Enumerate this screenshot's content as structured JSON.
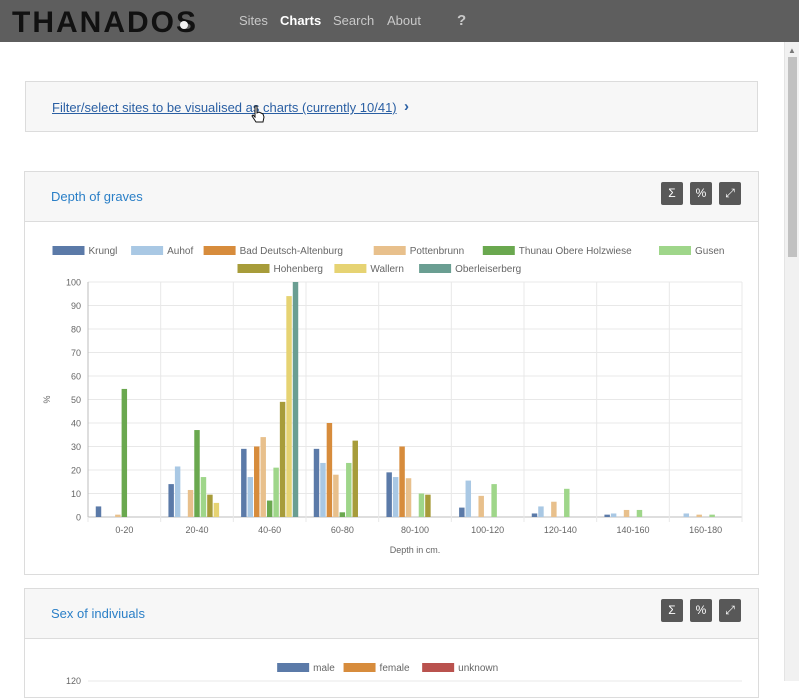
{
  "nav": {
    "logo_text": "THANADOS",
    "items": [
      "Sites",
      "Charts",
      "Search",
      "About"
    ],
    "active": "Charts",
    "help": "?"
  },
  "filter": {
    "link_text": "Filter/select sites to be visualised as charts (currently 10/41)",
    "chevron": "›"
  },
  "cards": [
    {
      "title": "Depth of graves",
      "buttons": [
        "Σ",
        "%",
        "⤢"
      ]
    },
    {
      "title": "Sex of indiviuals",
      "buttons": [
        "Σ",
        "%",
        "⤢"
      ]
    }
  ],
  "icons": [
    "logo-skull-icon",
    "help-icon",
    "chevron-right-icon",
    "sum-icon",
    "percent-icon",
    "expand-icon",
    "hand-cursor-icon"
  ],
  "chart_data": [
    {
      "type": "bar",
      "ylabel": "%",
      "xlabel": "Depth in cm.",
      "ylim": [
        0,
        100
      ],
      "yticks": [
        0,
        10,
        20,
        30,
        40,
        50,
        60,
        70,
        80,
        90,
        100
      ],
      "categories": [
        "0-20",
        "20-40",
        "40-60",
        "60-80",
        "80-100",
        "100-120",
        "120-140",
        "140-160",
        "160-180"
      ],
      "legend_position": "top",
      "grid": true,
      "series": [
        {
          "name": "Krungl",
          "color": "#5b7aa8",
          "values": [
            4.5,
            14,
            29,
            29,
            19,
            4,
            1.5,
            1,
            0
          ]
        },
        {
          "name": "Auhof",
          "color": "#a9c8e4",
          "values": [
            0,
            21.5,
            17,
            23,
            17,
            15.5,
            4.5,
            1.5,
            1.5
          ]
        },
        {
          "name": "Bad Deutsch-Altenburg",
          "color": "#d78c3c",
          "values": [
            0,
            0,
            30,
            40,
            30,
            0,
            0,
            0,
            0
          ]
        },
        {
          "name": "Pottenbrunn",
          "color": "#e8c08c",
          "values": [
            1,
            11.5,
            34,
            18,
            16.5,
            9,
            6.5,
            3,
            1
          ]
        },
        {
          "name": "Thunau Obere Holzwiese",
          "color": "#6aa84f",
          "values": [
            54.5,
            37,
            7,
            2,
            0,
            0,
            0,
            0,
            0
          ]
        },
        {
          "name": "Gusen",
          "color": "#9fd68a",
          "values": [
            0,
            17,
            21,
            23,
            10,
            14,
            12,
            3,
            1
          ]
        },
        {
          "name": "Hohenberg",
          "color": "#a79c3a",
          "values": [
            0,
            9.5,
            49,
            32.5,
            9.5,
            0,
            0,
            0,
            0
          ]
        },
        {
          "name": "Wallern",
          "color": "#e6d373",
          "values": [
            0,
            6,
            94,
            0,
            0,
            0,
            0,
            0,
            0
          ]
        },
        {
          "name": "Oberleiserberg",
          "color": "#6a9e92",
          "values": [
            0,
            0,
            100,
            0,
            0,
            0,
            0,
            0,
            0
          ]
        }
      ]
    },
    {
      "type": "bar",
      "yticks_visible": [
        120
      ],
      "legend_position": "top",
      "series": [
        {
          "name": "male",
          "color": "#5b7aa8"
        },
        {
          "name": "female",
          "color": "#d78c3c"
        },
        {
          "name": "unknown",
          "color": "#b9524e"
        }
      ]
    }
  ]
}
